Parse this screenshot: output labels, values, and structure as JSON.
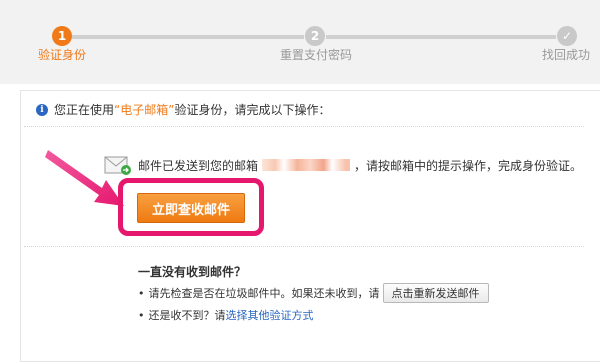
{
  "steps": [
    {
      "number": "1",
      "label": "验证身份",
      "state": "active"
    },
    {
      "number": "2",
      "label": "重置支付密码",
      "state": "pending"
    },
    {
      "number": "✓",
      "label": "找回成功",
      "state": "pending"
    }
  ],
  "colors": {
    "accent": "#f07a1a",
    "highlight_border": "#e6186e",
    "link": "#2a66c2",
    "inactive": "#c9c9c9"
  },
  "info": {
    "icon": "info-icon",
    "icon_glyph": "i",
    "prefix": "您正在使用 ",
    "method": "“电子邮箱”",
    "suffix": " 验证身份，请完成以下操作："
  },
  "mail": {
    "icon": "mail-icon",
    "sent_prefix": "邮件已发送到您的邮箱",
    "sent_suffix": "，请按邮箱中的提示操作，完成身份验证。",
    "open_button": "立即查收邮件"
  },
  "help": {
    "title": "一直没有收到邮件？",
    "line1_text": "请先检查是否在垃圾邮件中。如果还未收到，请",
    "resend_button": "点击重新发送邮件",
    "line2_text": "还是收不到？请",
    "other_method_link": "选择其他验证方式",
    "bullet": "•"
  }
}
